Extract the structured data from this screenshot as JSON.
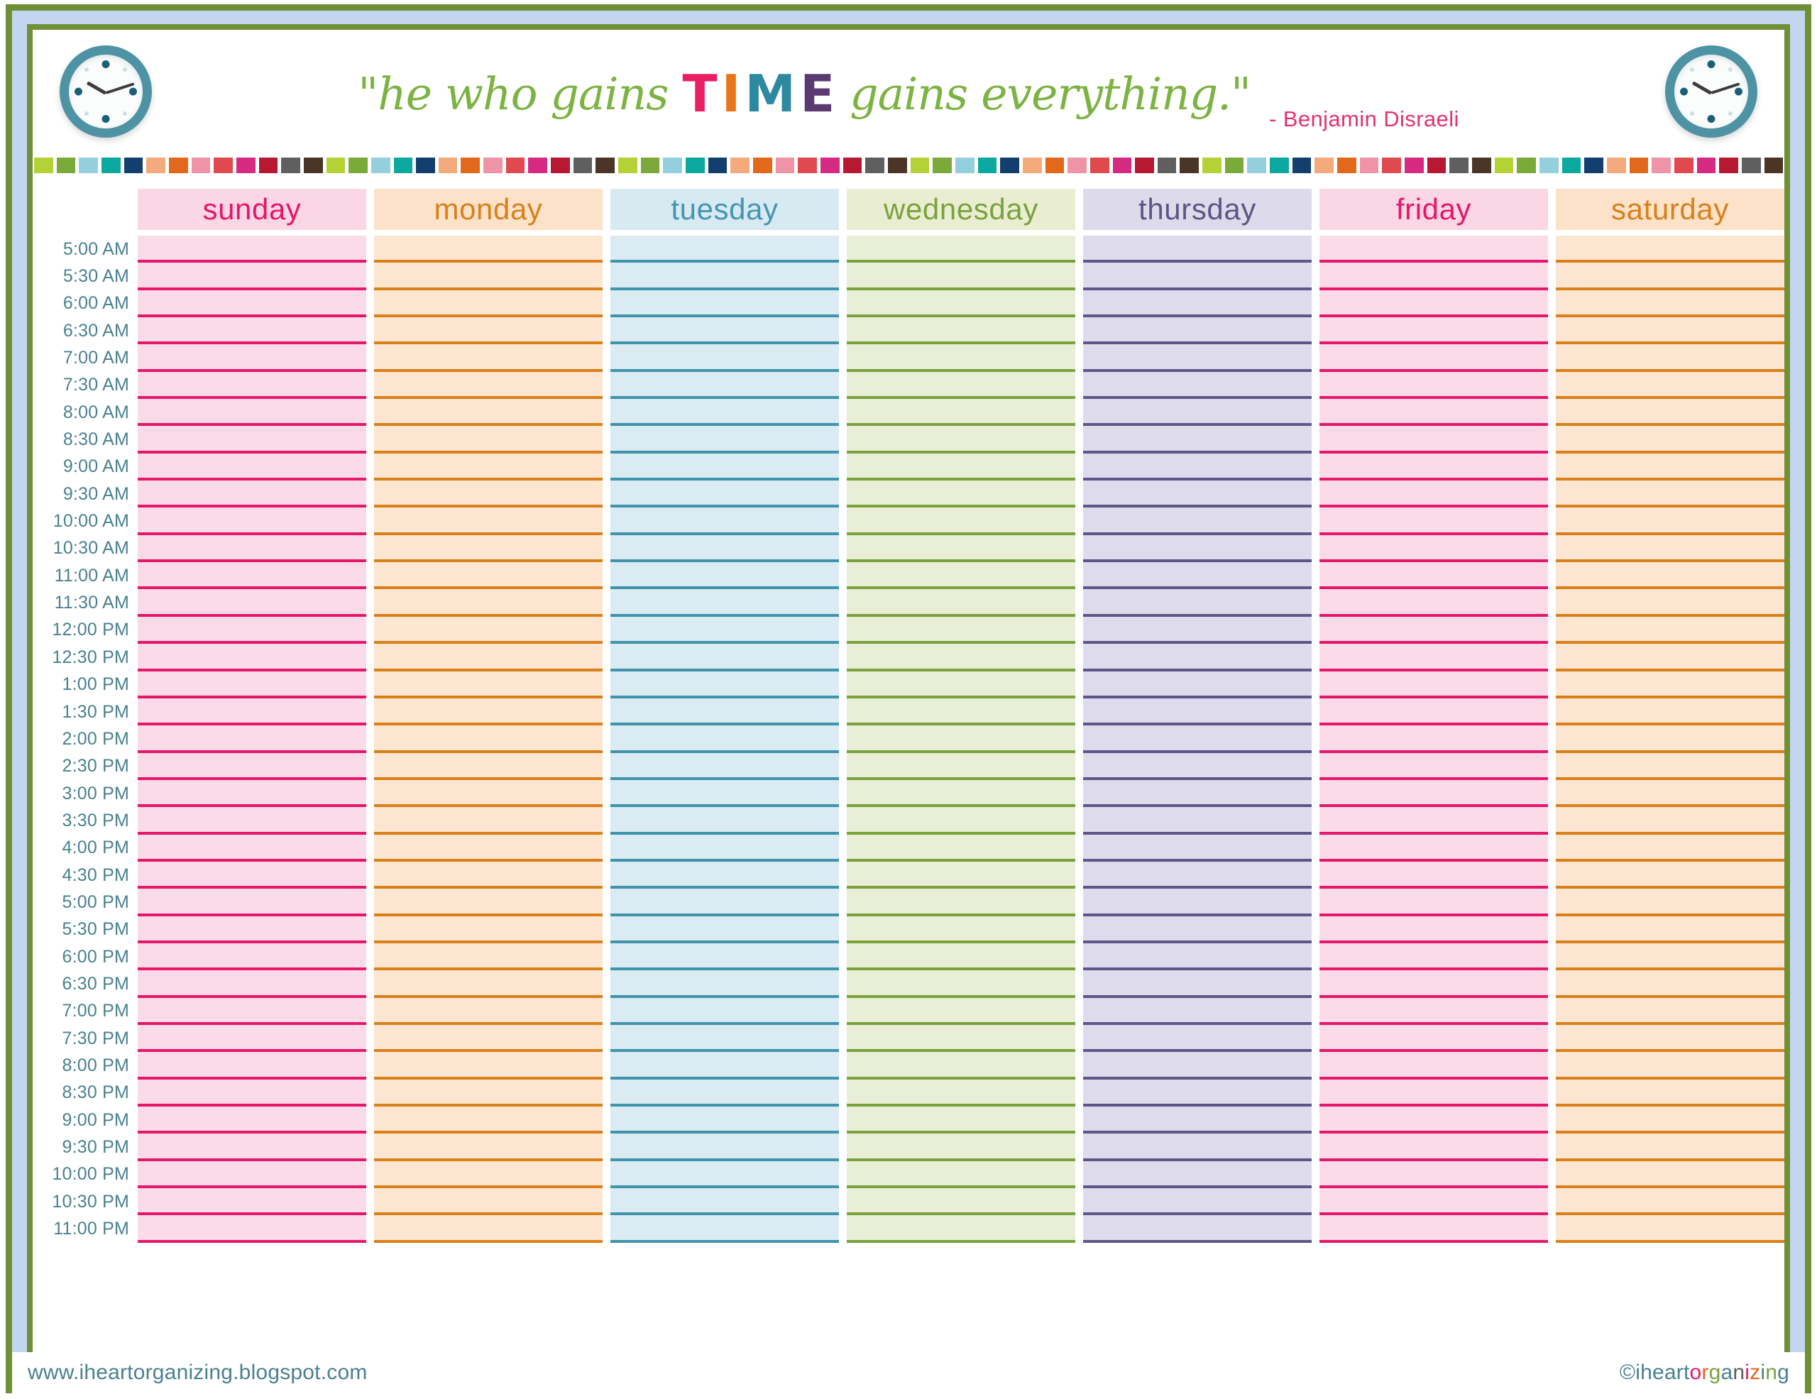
{
  "document": {
    "type": "weekly-hourly-planner",
    "frame": {
      "outer_border_color": "#6f9037",
      "band_color": "#c3d6ef",
      "inner_border_color": "#6f9037",
      "page_background": "#ffffff"
    }
  },
  "header": {
    "quote_part1": "\"he who gains",
    "quote_highlight": "TIME",
    "quote_highlight_letters": [
      {
        "char": "T",
        "color": "#ea1e63"
      },
      {
        "char": "I",
        "color": "#e8751a"
      },
      {
        "char": "M",
        "color": "#2c89a0"
      },
      {
        "char": "E",
        "color": "#5b3a72"
      }
    ],
    "quote_part2": "gains everything.\"",
    "attribution": "- Benjamin Disraeli",
    "script_color": "#7cb342",
    "attribution_color": "#e5316e",
    "clock_left": {
      "icon": "wall-clock-icon",
      "ring_color": "#4e93a4",
      "face_color": "#fbfcfc",
      "marker_color": "#1a5f78",
      "hand_color": "#3d3d3d",
      "hour_hand_angle": -150,
      "minute_hand_angle": -18
    },
    "clock_right": {
      "icon": "wall-clock-icon",
      "ring_color": "#4e93a4",
      "face_color": "#fbfcfc",
      "marker_color": "#1a5f78",
      "hand_color": "#3d3d3d",
      "hour_hand_angle": -150,
      "minute_hand_angle": -18
    }
  },
  "tile_border": {
    "repeat_colors": [
      "#b4d236",
      "#7aab3a",
      "#93cfdd",
      "#0ba8a0",
      "#123f6d",
      "#f3ab7d",
      "#e2681c",
      "#ef93a6",
      "#e04a4f",
      "#d62a82",
      "#b71933",
      "#5f5f5f",
      "#4a3526"
    ],
    "tile_count": 78
  },
  "days": [
    {
      "label": "sunday",
      "header_bg": "#fbd6e4",
      "header_text": "#e5176b",
      "slot_bg": "#fcdbe8",
      "line_color": "#e5176b"
    },
    {
      "label": "monday",
      "header_bg": "#fbe2c8",
      "header_text": "#d9801c",
      "slot_bg": "#fce6d2",
      "line_color": "#da8019"
    },
    {
      "label": "tuesday",
      "header_bg": "#d7e9f1",
      "header_text": "#4596b2",
      "slot_bg": "#daebf2",
      "line_color": "#3f93ac"
    },
    {
      "label": "wednesday",
      "header_bg": "#e9eed2",
      "header_text": "#7ba23c",
      "slot_bg": "#e9eed6",
      "line_color": "#79a23c"
    },
    {
      "label": "thursday",
      "header_bg": "#dddbeb",
      "header_text": "#5f5585",
      "slot_bg": "#dedcec",
      "line_color": "#5e5589"
    },
    {
      "label": "friday",
      "header_bg": "#fbd6e4",
      "header_text": "#e5176b",
      "slot_bg": "#fcdbe8",
      "line_color": "#e5176b"
    },
    {
      "label": "saturday",
      "header_bg": "#fbe2c8",
      "header_text": "#d9801c",
      "slot_bg": "#fce6d2",
      "line_color": "#da8019"
    }
  ],
  "time_slots": [
    "5:00 AM",
    "5:30 AM",
    "6:00 AM",
    "6:30 AM",
    "7:00 AM",
    "7:30 AM",
    "8:00 AM",
    "8:30 AM",
    "9:00 AM",
    "9:30 AM",
    "10:00 AM",
    "10:30 AM",
    "11:00 AM",
    "11:30 AM",
    "12:00 PM",
    "12:30 PM",
    "1:00 PM",
    "1:30 PM",
    "2:00 PM",
    "2:30 PM",
    "3:00 PM",
    "3:30 PM",
    "4:00 PM",
    "4:30 PM",
    "5:00 PM",
    "5:30 PM",
    "6:00 PM",
    "6:30 PM",
    "7:00 PM",
    "7:30 PM",
    "8:00 PM",
    "8:30 PM",
    "9:00 PM",
    "9:30 PM",
    "10:00 PM",
    "10:30 PM",
    "11:00 PM"
  ],
  "time_label_color": "#4a8190",
  "footer": {
    "url": "www.iheartorganizing.blogspot.com",
    "url_color": "#4a8190",
    "copyright_symbol": "©",
    "copyright_letters": [
      {
        "char": "©",
        "color": "#4a8190"
      },
      {
        "char": "i",
        "color": "#4a8190"
      },
      {
        "char": "h",
        "color": "#4a8190"
      },
      {
        "char": "e",
        "color": "#4a8190"
      },
      {
        "char": "a",
        "color": "#4a8190"
      },
      {
        "char": "r",
        "color": "#4a8190"
      },
      {
        "char": "t",
        "color": "#4a8190"
      },
      {
        "char": "o",
        "color": "#e5176b"
      },
      {
        "char": "r",
        "color": "#e2681c"
      },
      {
        "char": "g",
        "color": "#7ba23c"
      },
      {
        "char": "a",
        "color": "#4a8190"
      },
      {
        "char": "n",
        "color": "#5f5f5f"
      },
      {
        "char": "i",
        "color": "#e5176b"
      },
      {
        "char": "z",
        "color": "#e2681c"
      },
      {
        "char": "i",
        "color": "#4a8190"
      },
      {
        "char": "n",
        "color": "#7ba23c"
      },
      {
        "char": "g",
        "color": "#4a8190"
      }
    ],
    "copyright_text": "©iheartorganizing"
  }
}
